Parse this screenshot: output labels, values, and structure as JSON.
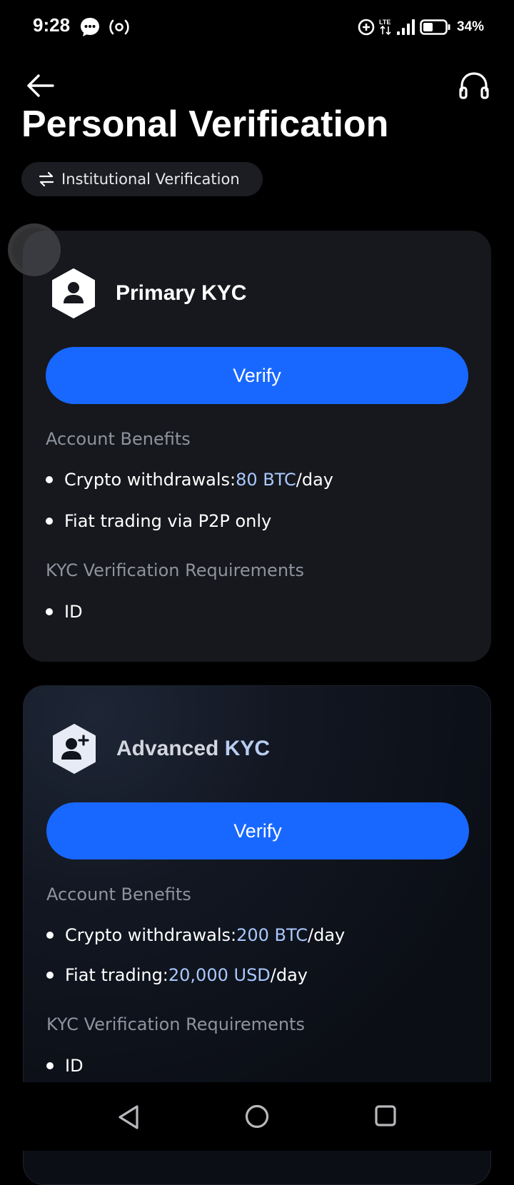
{
  "status_bar": {
    "time": "9:28",
    "battery": "34%",
    "icons": [
      "message-icon",
      "hotspot-icon",
      "data-saver-icon",
      "lte-icon",
      "signal-icon",
      "battery-icon"
    ]
  },
  "header": {
    "back_icon": "back-arrow-icon",
    "support_icon": "headset-icon",
    "title": "Personal Verification"
  },
  "switch_chip": {
    "label": "Institutional Verification",
    "icon": "swap-arrows-icon"
  },
  "cards": [
    {
      "title": "Primary KYC",
      "icon": "user-icon",
      "verify_label": "Verify",
      "benefits_label": "Account Benefits",
      "benefits": [
        {
          "prefix": "Crypto withdrawals: ",
          "highlight": "80 BTC",
          "suffix": "/day"
        },
        {
          "prefix": "Fiat trading via P2P only",
          "highlight": "",
          "suffix": ""
        }
      ],
      "requirements_label": "KYC Verification Requirements",
      "requirements": [
        "ID"
      ]
    },
    {
      "title_part1": "Advanced",
      "title_part2": "KYC",
      "icon": "user-plus-icon",
      "verify_label": "Verify",
      "benefits_label": "Account Benefits",
      "benefits": [
        {
          "prefix": "Crypto withdrawals: ",
          "highlight": "200 BTC",
          "suffix": "/day"
        },
        {
          "prefix": "Fiat trading: ",
          "highlight": "20,000 USD",
          "suffix": "/day"
        }
      ],
      "requirements_label": "KYC Verification Requirements",
      "requirements": [
        "ID"
      ]
    }
  ],
  "colors": {
    "background": "#000000",
    "card": "#16181d",
    "accent_button": "#1868ff",
    "highlight_text": "#a9c8ff",
    "muted_text": "#8e939e"
  }
}
